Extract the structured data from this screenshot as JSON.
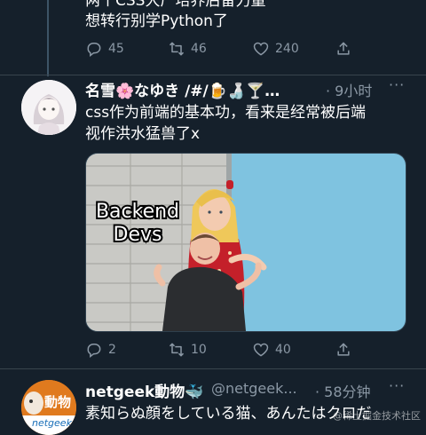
{
  "colors": {
    "bg": "#15202b",
    "muted": "#8b98a5",
    "divider": "#38444d",
    "wall_blue": "#7fc3e0",
    "bubble": "#2aa9e0"
  },
  "tweet1": {
    "text_line1": "两个CSS大厂培养后备力量",
    "text_line2": "想转行别学Python了",
    "actions": {
      "replies": "45",
      "retweets": "46",
      "likes": "240"
    }
  },
  "tweet2": {
    "display_name": "名雪🌸なゆき /#/🍺🍶🍸…",
    "time": "· 9小时",
    "more": "···",
    "text_line1": "css作为前端的基本功，看来是经常被后端",
    "text_line2": "视作洪水猛兽了x",
    "image": {
      "overlay_line1": "Backend",
      "overlay_line2": "Devs"
    },
    "actions": {
      "replies": "2",
      "retweets": "10",
      "likes": "40"
    }
  },
  "tweet3": {
    "display_name": "netgeek動物🐳",
    "handle": "@netgeek...",
    "time": "· 58分钟",
    "more": "···",
    "avatar_label": "動物",
    "avatar_sub": "netgeek",
    "text_line1": "素知らぬ顔をしている猫、あんたはクロだ"
  },
  "watermark": "@稀土掘金技术社区",
  "icons": [
    "reply-icon",
    "retweet-icon",
    "like-icon",
    "share-icon",
    "more-icon"
  ]
}
